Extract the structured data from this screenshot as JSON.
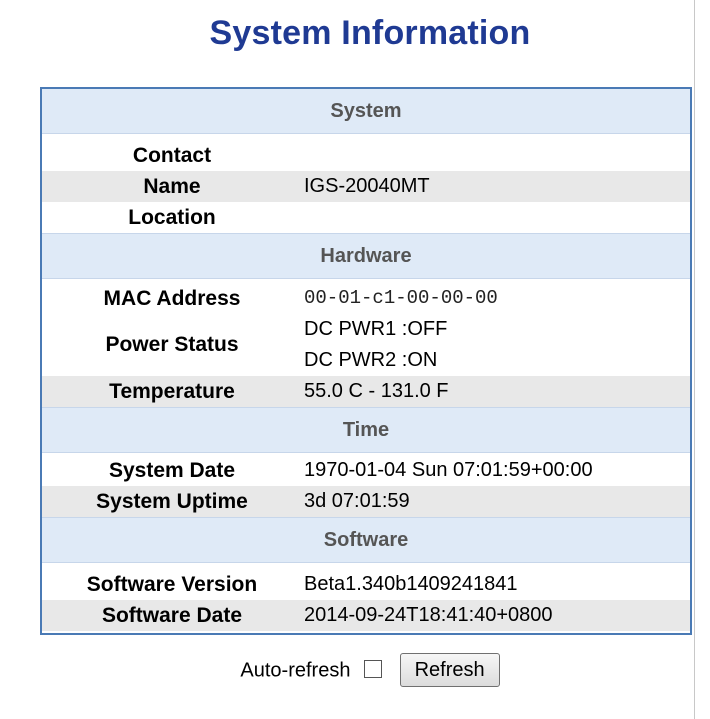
{
  "title": "System Information",
  "sections": {
    "system": "System",
    "hardware": "Hardware",
    "time": "Time",
    "software": "Software"
  },
  "system": {
    "contact": {
      "label": "Contact",
      "value": ""
    },
    "name": {
      "label": "Name",
      "value": "IGS-20040MT"
    },
    "location": {
      "label": "Location",
      "value": ""
    }
  },
  "hardware": {
    "mac": {
      "label": "MAC Address",
      "value": "00-01-c1-00-00-00"
    },
    "power": {
      "label": "Power Status",
      "line1": "DC PWR1 :OFF",
      "line2": "DC PWR2 :ON"
    },
    "temperature": {
      "label": "Temperature",
      "value": "55.0 C - 131.0 F"
    }
  },
  "time": {
    "date": {
      "label": "System Date",
      "value": "1970-01-04 Sun 07:01:59+00:00"
    },
    "uptime": {
      "label": "System Uptime",
      "value": "3d 07:01:59"
    }
  },
  "software": {
    "version": {
      "label": "Software Version",
      "value": "Beta1.340b1409241841"
    },
    "date": {
      "label": "Software Date",
      "value": "2014-09-24T18:41:40+0800"
    }
  },
  "controls": {
    "auto_refresh_label": "Auto-refresh",
    "auto_refresh_checked": false,
    "refresh_button": "Refresh"
  }
}
